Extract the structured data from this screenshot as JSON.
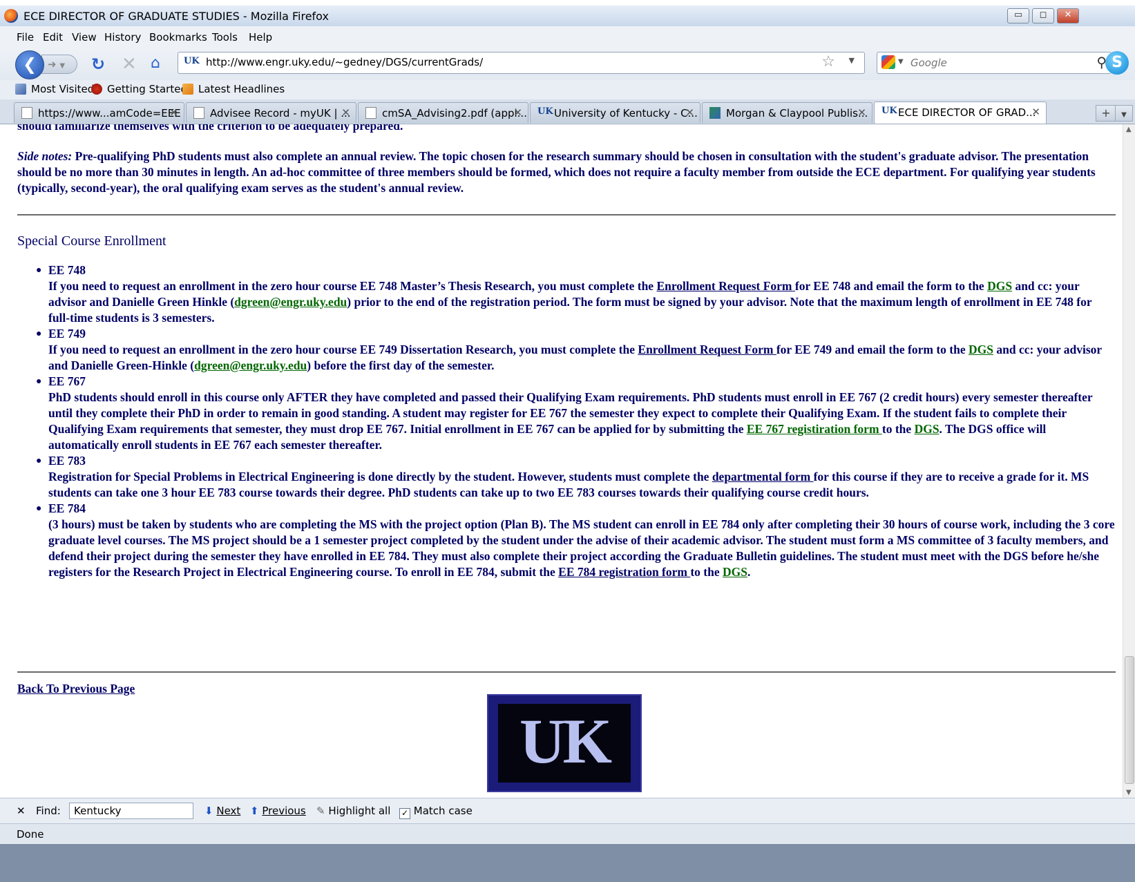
{
  "window": {
    "title": "ECE DIRECTOR OF GRADUATE STUDIES - Mozilla Firefox",
    "minimize": "▭",
    "maximize": "◻",
    "close": "✕"
  },
  "menu": [
    "File",
    "Edit",
    "View",
    "History",
    "Bookmarks",
    "Tools",
    "Help"
  ],
  "navbar": {
    "url": "http://www.engr.uky.edu/~gedney/DGS/currentGrads/",
    "site_badge": "UK",
    "search_placeholder": "Google"
  },
  "bookmarks": [
    "Most Visited",
    "Getting Started",
    "Latest Headlines"
  ],
  "tabs": [
    {
      "label": "https://www...amCode=EEE",
      "icon": "page-icon"
    },
    {
      "label": "Advisee Record - myUK | ...",
      "icon": "page-icon"
    },
    {
      "label": "cmSA_Advising2.pdf (appl...",
      "icon": "page-icon"
    },
    {
      "label": "University of Kentucky - C...",
      "icon": "uk-icon"
    },
    {
      "label": "Morgan & Claypool Publis...",
      "icon": "publisher-icon"
    },
    {
      "label": "ECE DIRECTOR OF GRAD...",
      "icon": "uk-icon"
    }
  ],
  "content": {
    "intro_line": "should familiarize themselves with the criterion to be adequately prepared.",
    "side_notes_label": "Side notes:",
    "side_notes": " Pre-qualifying PhD students must also complete an annual review. The topic chosen for the research summary should be chosen in consultation with the student's graduate advisor. The presentation should be no more than 30 minutes in length. An ad-hoc committee of three members should be formed, which does not require a faculty member from outside the ECE department. For qualifying year students (typically, second-year), the oral qualifying exam serves as the student's annual review.",
    "section_title": "Special Course Enrollment",
    "courses": {
      "ee748": {
        "code": "EE 748",
        "t1": "If you need to request an enrollment in the zero hour course EE 748 Master’s Thesis Research, you must complete the ",
        "link1": "Enrollment Request Form ",
        "t2": "for EE 748 and email the form to the ",
        "link2": "DGS",
        "t3": " and cc: your advisor and Danielle Green Hinkle (",
        "link3": "dgreen@engr.uky.edu",
        "t4": ") prior to the end of the registration period. The form must be signed by your advisor. Note that the maximum length of enrollment in EE 748 for full-time students is 3 semesters."
      },
      "ee749": {
        "code": "EE 749",
        "t1": "If you need to request an enrollment in the zero hour course EE 749 Dissertation Research, you must complete the ",
        "link1": "Enrollment Request Form ",
        "t2": "for EE 749 and email the form to the ",
        "link2": "DGS",
        "t3": " and cc: your advisor and Danielle Green-Hinkle (",
        "link3": "dgreen@engr.uky.edu",
        "t4": ") before the first day of the semester."
      },
      "ee767": {
        "code": "EE 767",
        "t1": "PhD students should enroll in this course only AFTER they have completed and passed their Qualifying Exam requirements. PhD students must enroll in EE 767 (2 credit hours) every semester thereafter until they complete their PhD in order to remain in good standing. A student may register for EE 767 the semester they expect to complete their Qualifying Exam. If the student fails to complete their Qualifying Exam requirements that semester, they must drop EE 767. Initial enrollment in EE 767 can be applied for by submitting the ",
        "link1": "EE 767 registiration form ",
        "t2": "to the ",
        "link2": "DGS",
        "t3": ". The DGS office will automatically enroll students in EE 767 each semester thereafter."
      },
      "ee783": {
        "code": "EE 783",
        "t1": "Registration for Special Problems in Electrical Engineering is done directly by the student. However, students must complete the ",
        "link1": "departmental form ",
        "t2": "for this course if they are to receive a grade for it. MS students can take one 3 hour EE 783 course towards their degree. PhD students can take up to two EE 783 courses towards their qualifying course credit hours."
      },
      "ee784": {
        "code": "EE 784",
        "t1": "(3 hours) must be taken by students who are completing the MS with the project option (Plan B). The MS student can enroll in EE 784 only after completing their 30 hours of course work, including the 3 core graduate level courses. The MS project should be a 1 semester project completed by the student under the advise of their academic advisor. The student must form a MS committee of 3 faculty members, and defend their project during the semester they have enrolled in EE 784. They must also complete their project according the Graduate Bulletin guidelines. The student must meet with the DGS before he/she registers for the Research Project in Electrical Engineering course. To enroll in EE 784, submit the ",
        "link1": "EE 784 registration form ",
        "t2": "to the ",
        "link2": "DGS",
        "t3": "."
      }
    },
    "back_link": "Back To Previous Page",
    "logo_text": "UK"
  },
  "findbar": {
    "close": "✕",
    "label": "Find:",
    "value": "Kentucky",
    "next": "Next",
    "previous": "Previous",
    "highlight": "Highlight all",
    "match_case": "Match case"
  },
  "status": "Done"
}
